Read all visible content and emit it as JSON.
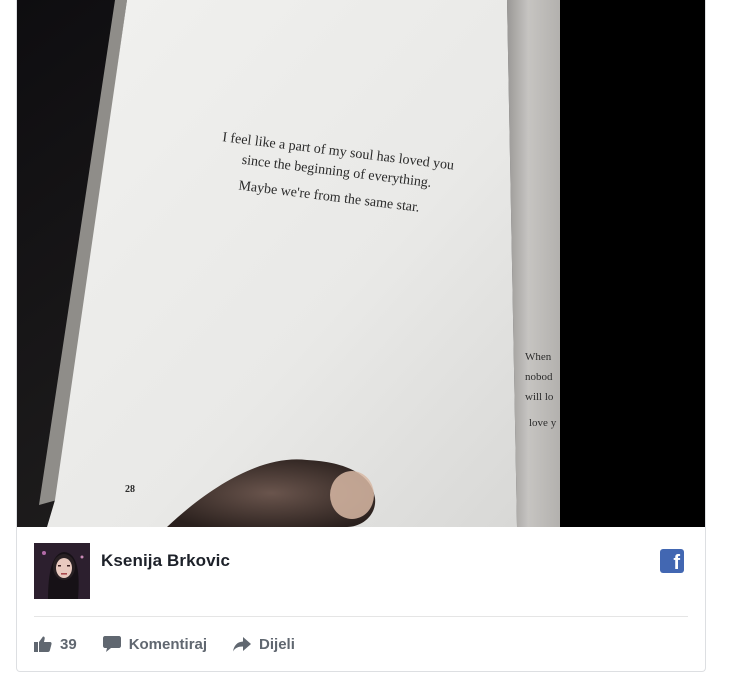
{
  "photo": {
    "quote_line1": "I feel like a part of my soul has loved you",
    "quote_line2": "since the beginning of everything.",
    "quote_line3": "Maybe we're from the same star.",
    "page_number": "28",
    "side_line1": "When",
    "side_line2": "nobod",
    "side_line3": "will lo",
    "side_line4": "love y"
  },
  "author": {
    "name": "Ksenija Brkovic"
  },
  "actions": {
    "likes_count": "39",
    "comment_label": "Komentiraj",
    "share_label": "Dijeli"
  },
  "colors": {
    "facebook_blue": "#4267b2",
    "action_gray": "#606770",
    "name_color": "#1d2129"
  },
  "icons": {
    "brand": "facebook-logo-icon",
    "like": "thumbs-up-icon",
    "comment": "comment-bubble-icon",
    "share": "share-arrow-icon"
  }
}
